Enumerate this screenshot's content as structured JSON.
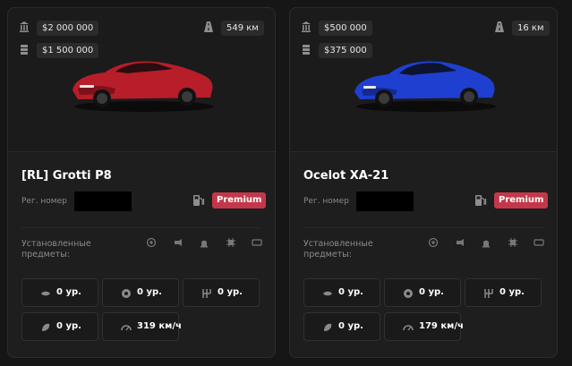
{
  "cards": [
    {
      "price": "$2 000 000",
      "resale": "$1 500 000",
      "mileage": "549 км",
      "name": "[RL] Grotti P8",
      "reg_label": "Рег. номер",
      "badge": "Premium",
      "installed_label": "Установленные предметы:",
      "car_color": "#b81d2a",
      "stats": [
        "0 ур.",
        "0 ур.",
        "0 ур.",
        "0 ур.",
        "319 км/ч"
      ]
    },
    {
      "price": "$500 000",
      "resale": "$375 000",
      "mileage": "16 км",
      "name": "Ocelot XA-21",
      "reg_label": "Рег. номер",
      "badge": "Premium",
      "installed_label": "Установленные предметы:",
      "car_color": "#1f3fd1",
      "stats": [
        "0 ур.",
        "0 ур.",
        "0 ур.",
        "0 ур.",
        "179 км/ч"
      ]
    }
  ],
  "colors": {
    "badge": "#c4374a",
    "card_bg": "#1e1e1e",
    "page_bg": "#161616"
  },
  "icons": {
    "price": "bank-icon",
    "resale": "cash-stack-icon",
    "mileage": "road-icon",
    "fuel": "fuel-pump-icon",
    "mods": [
      "target-icon",
      "engine-icon",
      "siren-icon",
      "chip-icon",
      "plate-icon"
    ],
    "stats": [
      "turbo-icon",
      "brake-icon",
      "gearbox-icon",
      "suspension-icon",
      "speedometer-icon"
    ]
  }
}
